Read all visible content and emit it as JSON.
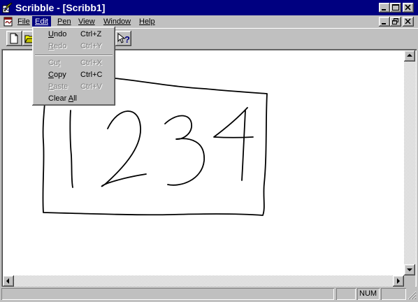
{
  "window": {
    "title": "Scribble - [Scribb1]"
  },
  "menubar": {
    "items": [
      {
        "key": "file",
        "label": "File",
        "mnemonic": "F"
      },
      {
        "key": "edit",
        "label": "Edit",
        "mnemonic": "E"
      },
      {
        "key": "pen",
        "label": "Pen",
        "mnemonic": "P"
      },
      {
        "key": "view",
        "label": "View",
        "mnemonic": "V"
      },
      {
        "key": "window",
        "label": "Window",
        "mnemonic": "W"
      },
      {
        "key": "help",
        "label": "Help",
        "mnemonic": "H"
      }
    ],
    "active": "Edit"
  },
  "edit_menu": {
    "items": [
      {
        "label": "Undo",
        "shortcut": "Ctrl+Z",
        "enabled": true
      },
      {
        "label": "Redo",
        "shortcut": "Ctrl+Y",
        "enabled": false
      },
      {
        "label": "Cut",
        "shortcut": "Ctrl+X",
        "enabled": false
      },
      {
        "label": "Copy",
        "shortcut": "Ctrl+C",
        "enabled": true
      },
      {
        "label": "Paste",
        "shortcut": "Ctrl+V",
        "enabled": false
      },
      {
        "label": "Clear All",
        "shortcut": "",
        "enabled": true
      }
    ]
  },
  "toolbar": {
    "buttons": [
      "new-document-icon",
      "open-folder-icon",
      "context-help-icon"
    ]
  },
  "canvas": {
    "drawing": "handwritten 1234 inside a rectangle",
    "ink_color": "#000000"
  },
  "statusbar": {
    "message": "",
    "num_indicator": "NUM"
  },
  "colors": {
    "titlebar": "#000080",
    "face": "#c0c0c0",
    "highlight": "#000080"
  }
}
